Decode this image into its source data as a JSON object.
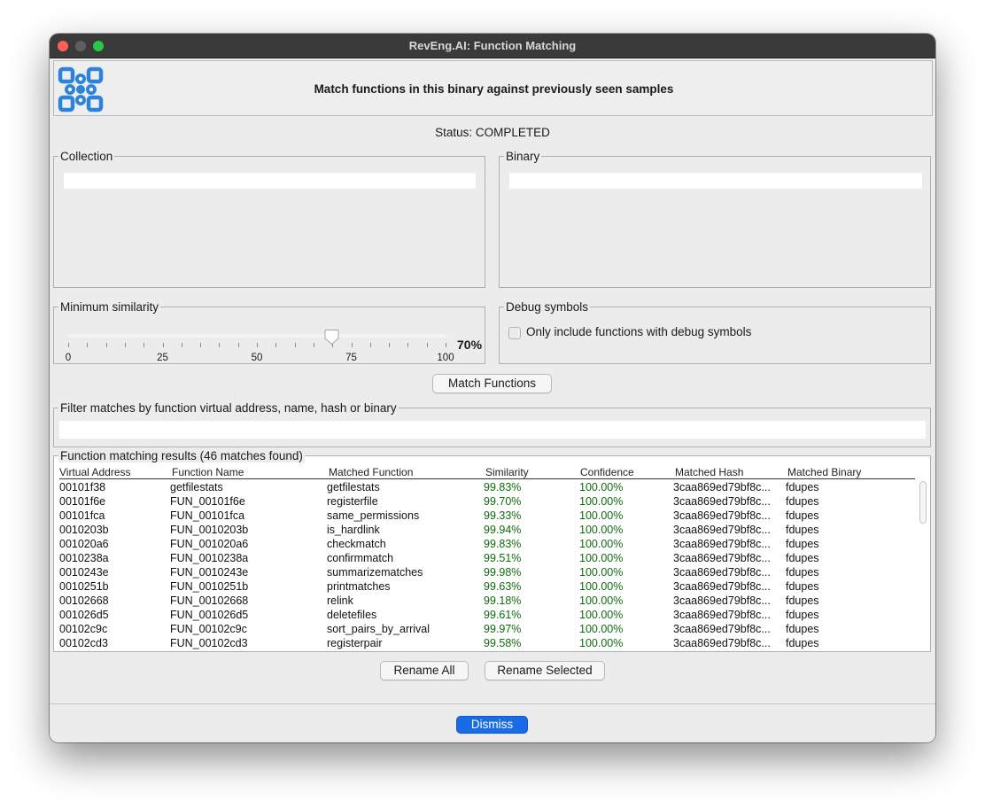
{
  "window": {
    "title": "RevEng.AI: Function Matching"
  },
  "header": {
    "text": "Match functions in this binary against previously seen samples"
  },
  "status": {
    "text": "Status: COMPLETED"
  },
  "collection": {
    "title": "Collection",
    "value": ""
  },
  "binary": {
    "title": "Binary",
    "value": ""
  },
  "similarity": {
    "title": "Minimum similarity",
    "value": 70,
    "value_label": "70%",
    "min": 0,
    "max": 100,
    "tick_labels": [
      "0",
      "25",
      "50",
      "75",
      "100"
    ]
  },
  "debug": {
    "title": "Debug symbols",
    "checkbox_label": "Only include functions with debug symbols",
    "checked": false
  },
  "actions": {
    "match_label": "Match Functions",
    "rename_all_label": "Rename All",
    "rename_selected_label": "Rename Selected",
    "dismiss_label": "Dismiss"
  },
  "filter": {
    "title": "Filter matches by function virtual address, name, hash or binary",
    "value": ""
  },
  "results": {
    "title": "Function matching results (46 matches found)",
    "columns": [
      "Virtual Address",
      "Function Name",
      "Matched Function",
      "Similarity",
      "Confidence",
      "Matched Hash",
      "Matched Binary"
    ],
    "rows": [
      [
        "00101f38",
        "getfilestats",
        "getfilestats",
        "99.83%",
        "100.00%",
        "3caa869ed79bf8c...",
        "fdupes"
      ],
      [
        "00101f6e",
        "FUN_00101f6e",
        "registerfile",
        "99.70%",
        "100.00%",
        "3caa869ed79bf8c...",
        "fdupes"
      ],
      [
        "00101fca",
        "FUN_00101fca",
        "same_permissions",
        "99.33%",
        "100.00%",
        "3caa869ed79bf8c...",
        "fdupes"
      ],
      [
        "0010203b",
        "FUN_0010203b",
        "is_hardlink",
        "99.94%",
        "100.00%",
        "3caa869ed79bf8c...",
        "fdupes"
      ],
      [
        "001020a6",
        "FUN_001020a6",
        "checkmatch",
        "99.83%",
        "100.00%",
        "3caa869ed79bf8c...",
        "fdupes"
      ],
      [
        "0010238a",
        "FUN_0010238a",
        "confirmmatch",
        "99.51%",
        "100.00%",
        "3caa869ed79bf8c...",
        "fdupes"
      ],
      [
        "0010243e",
        "FUN_0010243e",
        "summarizematches",
        "99.98%",
        "100.00%",
        "3caa869ed79bf8c...",
        "fdupes"
      ],
      [
        "0010251b",
        "FUN_0010251b",
        "printmatches",
        "99.63%",
        "100.00%",
        "3caa869ed79bf8c...",
        "fdupes"
      ],
      [
        "00102668",
        "FUN_00102668",
        "relink",
        "99.18%",
        "100.00%",
        "3caa869ed79bf8c...",
        "fdupes"
      ],
      [
        "001026d5",
        "FUN_001026d5",
        "deletefiles",
        "99.61%",
        "100.00%",
        "3caa869ed79bf8c...",
        "fdupes"
      ],
      [
        "00102c9c",
        "FUN_00102c9c",
        "sort_pairs_by_arrival",
        "99.97%",
        "100.00%",
        "3caa869ed79bf8c...",
        "fdupes"
      ],
      [
        "00102cd3",
        "FUN_00102cd3",
        "registerpair",
        "99.58%",
        "100.00%",
        "3caa869ed79bf8c...",
        "fdupes"
      ]
    ]
  },
  "colors": {
    "accent": "#1a6be6",
    "logo_blue": "#2b84d9",
    "percent_green": "#0e6b0e",
    "titlebar": "#3a3a3a"
  },
  "icons": {
    "logo": "reveng-logo-icon",
    "slider_thumb": "slider-thumb-icon"
  }
}
